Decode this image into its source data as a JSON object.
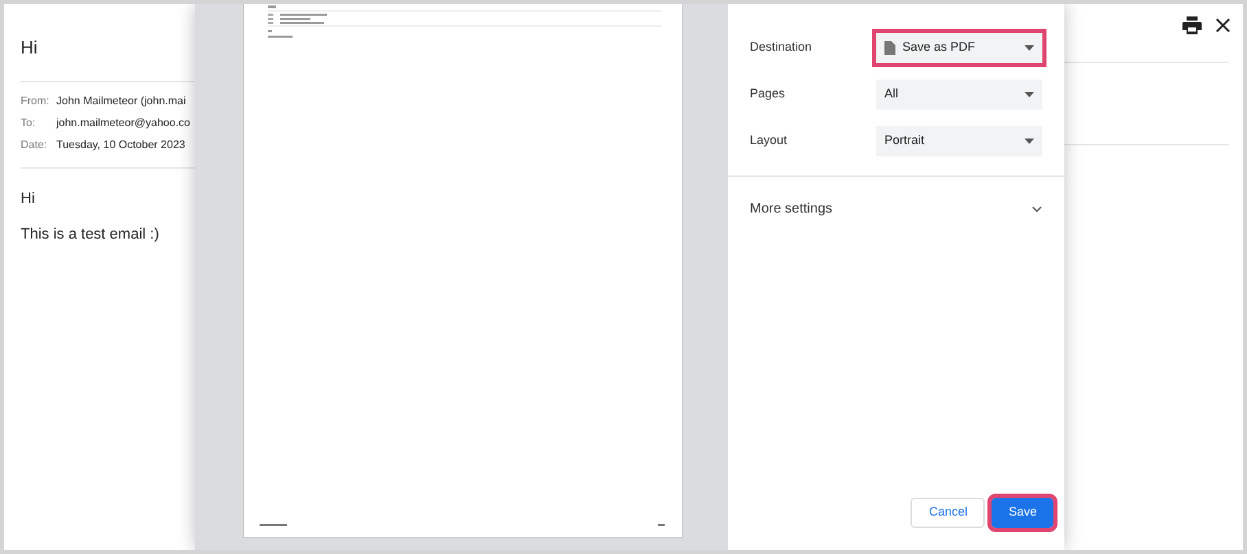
{
  "email": {
    "subject": "Hi",
    "headers": [
      {
        "label": "From:",
        "value": "John Mailmeteor (john.mai"
      },
      {
        "label": "To:",
        "value": "john.mailmeteor@yahoo.co"
      },
      {
        "label": "Date:",
        "value": "Tuesday, 10 October 2023"
      }
    ],
    "body": [
      "Hi",
      "This is a test email :)"
    ]
  },
  "print_dialog": {
    "settings": [
      {
        "label": "Destination",
        "value": "Save as PDF",
        "kind": "destination",
        "highlighted": true
      },
      {
        "label": "Pages",
        "value": "All",
        "kind": "plain",
        "highlighted": false
      },
      {
        "label": "Layout",
        "value": "Portrait",
        "kind": "plain",
        "highlighted": false
      }
    ],
    "more_settings": {
      "label": "More settings",
      "expanded": false
    },
    "buttons": [
      {
        "label": "Cancel",
        "kind": "secondary",
        "highlighted": false
      },
      {
        "label": "Save",
        "kind": "primary",
        "highlighted": true
      }
    ]
  }
}
